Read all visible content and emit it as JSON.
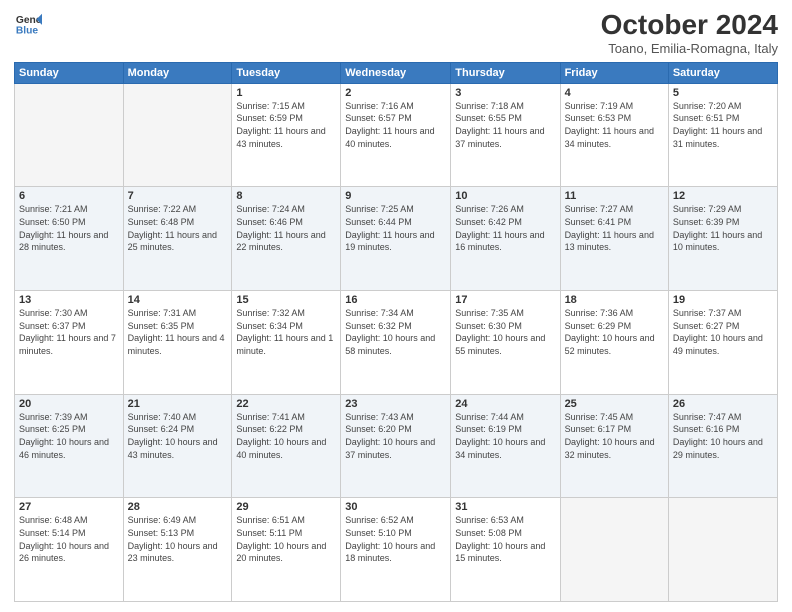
{
  "logo": {
    "line1": "General",
    "line2": "Blue"
  },
  "title": "October 2024",
  "location": "Toano, Emilia-Romagna, Italy",
  "days_of_week": [
    "Sunday",
    "Monday",
    "Tuesday",
    "Wednesday",
    "Thursday",
    "Friday",
    "Saturday"
  ],
  "weeks": [
    [
      {
        "day": "",
        "info": ""
      },
      {
        "day": "",
        "info": ""
      },
      {
        "day": "1",
        "info": "Sunrise: 7:15 AM\nSunset: 6:59 PM\nDaylight: 11 hours and 43 minutes."
      },
      {
        "day": "2",
        "info": "Sunrise: 7:16 AM\nSunset: 6:57 PM\nDaylight: 11 hours and 40 minutes."
      },
      {
        "day": "3",
        "info": "Sunrise: 7:18 AM\nSunset: 6:55 PM\nDaylight: 11 hours and 37 minutes."
      },
      {
        "day": "4",
        "info": "Sunrise: 7:19 AM\nSunset: 6:53 PM\nDaylight: 11 hours and 34 minutes."
      },
      {
        "day": "5",
        "info": "Sunrise: 7:20 AM\nSunset: 6:51 PM\nDaylight: 11 hours and 31 minutes."
      }
    ],
    [
      {
        "day": "6",
        "info": "Sunrise: 7:21 AM\nSunset: 6:50 PM\nDaylight: 11 hours and 28 minutes."
      },
      {
        "day": "7",
        "info": "Sunrise: 7:22 AM\nSunset: 6:48 PM\nDaylight: 11 hours and 25 minutes."
      },
      {
        "day": "8",
        "info": "Sunrise: 7:24 AM\nSunset: 6:46 PM\nDaylight: 11 hours and 22 minutes."
      },
      {
        "day": "9",
        "info": "Sunrise: 7:25 AM\nSunset: 6:44 PM\nDaylight: 11 hours and 19 minutes."
      },
      {
        "day": "10",
        "info": "Sunrise: 7:26 AM\nSunset: 6:42 PM\nDaylight: 11 hours and 16 minutes."
      },
      {
        "day": "11",
        "info": "Sunrise: 7:27 AM\nSunset: 6:41 PM\nDaylight: 11 hours and 13 minutes."
      },
      {
        "day": "12",
        "info": "Sunrise: 7:29 AM\nSunset: 6:39 PM\nDaylight: 11 hours and 10 minutes."
      }
    ],
    [
      {
        "day": "13",
        "info": "Sunrise: 7:30 AM\nSunset: 6:37 PM\nDaylight: 11 hours and 7 minutes."
      },
      {
        "day": "14",
        "info": "Sunrise: 7:31 AM\nSunset: 6:35 PM\nDaylight: 11 hours and 4 minutes."
      },
      {
        "day": "15",
        "info": "Sunrise: 7:32 AM\nSunset: 6:34 PM\nDaylight: 11 hours and 1 minute."
      },
      {
        "day": "16",
        "info": "Sunrise: 7:34 AM\nSunset: 6:32 PM\nDaylight: 10 hours and 58 minutes."
      },
      {
        "day": "17",
        "info": "Sunrise: 7:35 AM\nSunset: 6:30 PM\nDaylight: 10 hours and 55 minutes."
      },
      {
        "day": "18",
        "info": "Sunrise: 7:36 AM\nSunset: 6:29 PM\nDaylight: 10 hours and 52 minutes."
      },
      {
        "day": "19",
        "info": "Sunrise: 7:37 AM\nSunset: 6:27 PM\nDaylight: 10 hours and 49 minutes."
      }
    ],
    [
      {
        "day": "20",
        "info": "Sunrise: 7:39 AM\nSunset: 6:25 PM\nDaylight: 10 hours and 46 minutes."
      },
      {
        "day": "21",
        "info": "Sunrise: 7:40 AM\nSunset: 6:24 PM\nDaylight: 10 hours and 43 minutes."
      },
      {
        "day": "22",
        "info": "Sunrise: 7:41 AM\nSunset: 6:22 PM\nDaylight: 10 hours and 40 minutes."
      },
      {
        "day": "23",
        "info": "Sunrise: 7:43 AM\nSunset: 6:20 PM\nDaylight: 10 hours and 37 minutes."
      },
      {
        "day": "24",
        "info": "Sunrise: 7:44 AM\nSunset: 6:19 PM\nDaylight: 10 hours and 34 minutes."
      },
      {
        "day": "25",
        "info": "Sunrise: 7:45 AM\nSunset: 6:17 PM\nDaylight: 10 hours and 32 minutes."
      },
      {
        "day": "26",
        "info": "Sunrise: 7:47 AM\nSunset: 6:16 PM\nDaylight: 10 hours and 29 minutes."
      }
    ],
    [
      {
        "day": "27",
        "info": "Sunrise: 6:48 AM\nSunset: 5:14 PM\nDaylight: 10 hours and 26 minutes."
      },
      {
        "day": "28",
        "info": "Sunrise: 6:49 AM\nSunset: 5:13 PM\nDaylight: 10 hours and 23 minutes."
      },
      {
        "day": "29",
        "info": "Sunrise: 6:51 AM\nSunset: 5:11 PM\nDaylight: 10 hours and 20 minutes."
      },
      {
        "day": "30",
        "info": "Sunrise: 6:52 AM\nSunset: 5:10 PM\nDaylight: 10 hours and 18 minutes."
      },
      {
        "day": "31",
        "info": "Sunrise: 6:53 AM\nSunset: 5:08 PM\nDaylight: 10 hours and 15 minutes."
      },
      {
        "day": "",
        "info": ""
      },
      {
        "day": "",
        "info": ""
      }
    ]
  ]
}
